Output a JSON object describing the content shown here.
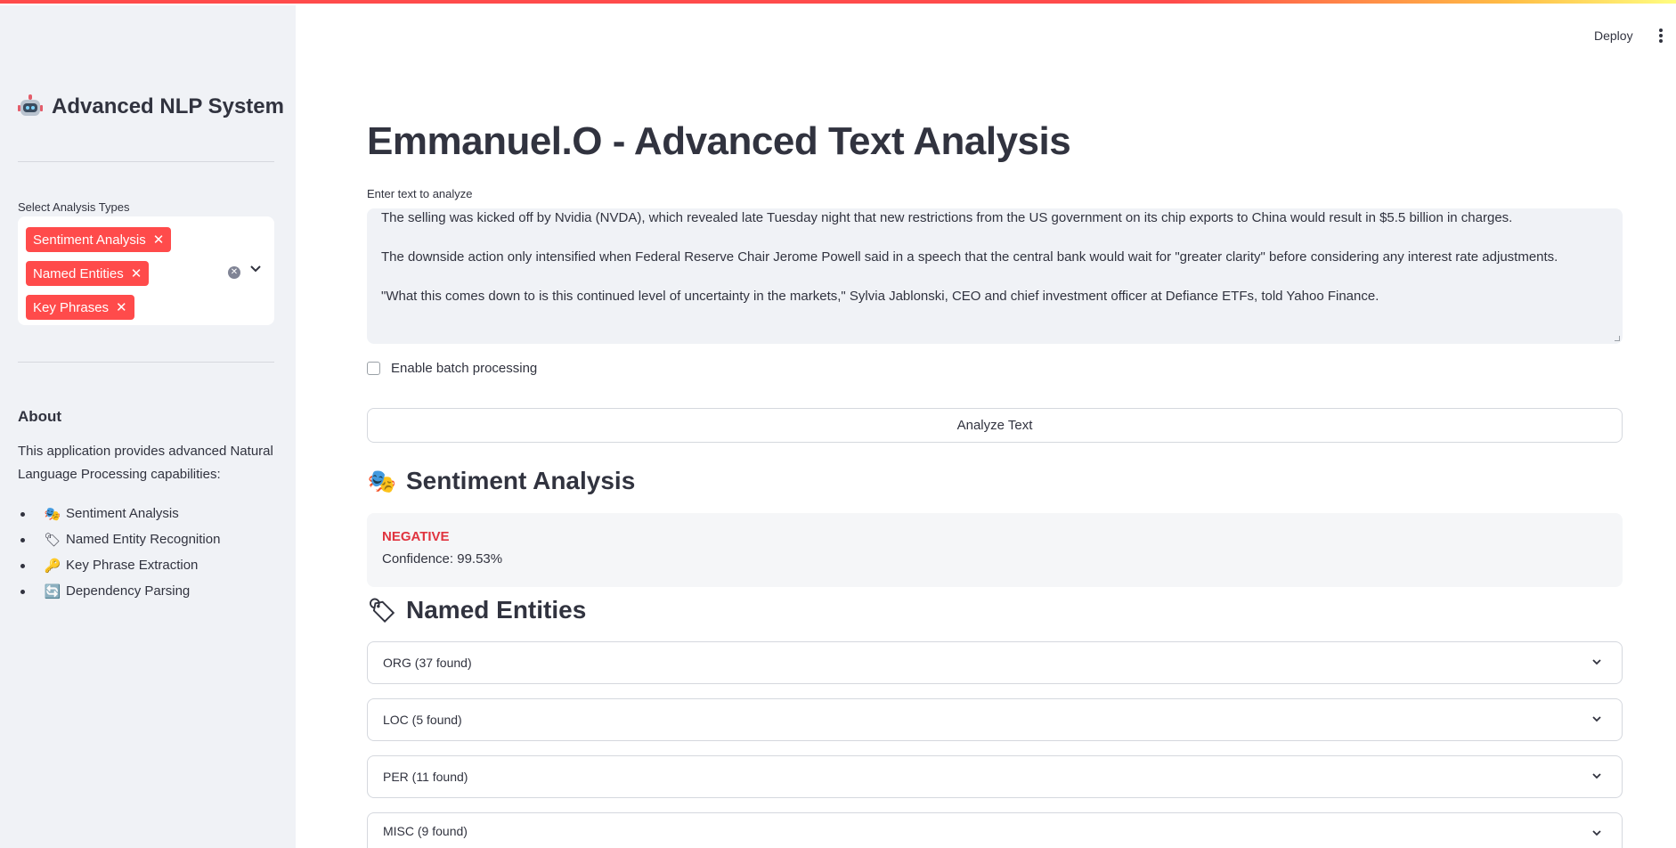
{
  "sidebar": {
    "title": "Advanced NLP System",
    "select_label": "Select Analysis Types",
    "selected": [
      "Sentiment Analysis",
      "Named Entities",
      "Key Phrases"
    ],
    "about_heading": "About",
    "about_text": "This application provides advanced Natural Language Processing capabilities:",
    "features": [
      {
        "icon": "theater-masks-icon",
        "label": "Sentiment Analysis"
      },
      {
        "icon": "label-tag-icon",
        "label": "Named Entity Recognition"
      },
      {
        "icon": "key-icon",
        "label": "Key Phrase Extraction"
      },
      {
        "icon": "repeat-icon",
        "label": "Dependency Parsing"
      }
    ]
  },
  "header": {
    "deploy_label": "Deploy"
  },
  "main": {
    "title": "Emmanuel.O - Advanced Text Analysis",
    "textarea_label": "Enter text to analyze",
    "textarea_lines": [
      "The selling was kicked off by Nvidia (NVDA), which revealed late Tuesday night that new restrictions from the US government on its chip exports to China would result in $5.5 billion in charges.",
      "The downside action only intensified when Federal Reserve Chair Jerome Powell said in a speech that the central bank would wait for \"greater clarity\" before considering any interest rate adjustments.",
      "\"What this comes down to is this continued level of uncertainty in the markets,\" Sylvia Jablonski, CEO and chief investment officer at Defiance ETFs, told Yahoo Finance."
    ],
    "batch_label": "Enable batch processing",
    "analyze_button": "Analyze Text",
    "sentiment": {
      "heading": "Sentiment Analysis",
      "label": "NEGATIVE",
      "confidence": "Confidence: 99.53%",
      "label_color": "#e0343f"
    },
    "entities": {
      "heading": "Named Entities",
      "groups": [
        "ORG (37 found)",
        "LOC (5 found)",
        "PER (11 found)",
        "MISC (9 found)"
      ]
    }
  },
  "colors": {
    "accent": "#ff4b4b",
    "sidebar_bg": "#f0f2f6",
    "text": "#31333f"
  }
}
